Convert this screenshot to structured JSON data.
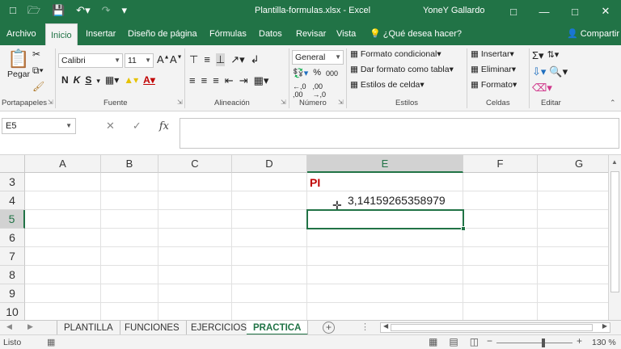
{
  "app": {
    "window_title": "Plantilla-formulas.xlsx  -  Excel",
    "user": "YoneY Gallardo",
    "accent": "#217346"
  },
  "qat": {
    "icons": [
      "new-file-icon",
      "open-folder-icon",
      "save-icon",
      "undo-icon",
      "redo-icon",
      "customize-qat-icon"
    ]
  },
  "window_controls": {
    "icons": [
      "ribbon-display-icon",
      "minimize-icon",
      "maximize-icon",
      "close-icon"
    ]
  },
  "tabs": [
    {
      "label": "Archivo"
    },
    {
      "label": "Inicio",
      "active": true
    },
    {
      "label": "Insertar"
    },
    {
      "label": "Diseño de página"
    },
    {
      "label": "Fórmulas"
    },
    {
      "label": "Datos"
    },
    {
      "label": "Revisar"
    },
    {
      "label": "Vista"
    }
  ],
  "tell_me": "¿Qué desea hacer?",
  "share": "Compartir",
  "ribbon": {
    "clipboard": {
      "paste": "Pegar",
      "group": "Portapapeles"
    },
    "font": {
      "name": "Calibri",
      "size": "11",
      "bold": "N",
      "italic": "K",
      "underline": "S",
      "group": "Fuente"
    },
    "alignment": {
      "group": "Alineación"
    },
    "number": {
      "format": "General",
      "group": "Número"
    },
    "styles": {
      "conditional": "Formato condicional",
      "as_table": "Dar formato como tabla",
      "cell_styles": "Estilos de celda",
      "group": "Estilos"
    },
    "cells": {
      "insert": "Insertar",
      "delete": "Eliminar",
      "format": "Formato",
      "group": "Celdas"
    },
    "editing": {
      "group": "Editar"
    }
  },
  "formula_bar": {
    "name_box": "E5",
    "fx": "fx",
    "value": ""
  },
  "grid": {
    "columns": [
      "A",
      "B",
      "C",
      "D",
      "E",
      "F",
      "G"
    ],
    "selected_column": "E",
    "rows": [
      "3",
      "4",
      "5",
      "6",
      "7",
      "8",
      "9",
      "10"
    ],
    "selected_row": "5",
    "cells": {
      "E3": "PI",
      "E4": "3,14159265358979"
    },
    "label_color": "#c00000"
  },
  "sheets": [
    {
      "label": "PLANTILLA"
    },
    {
      "label": "FUNCIONES"
    },
    {
      "label": "EJERCICIOS"
    },
    {
      "label": "PRACTICA",
      "active": true
    }
  ],
  "status": {
    "ready": "Listo",
    "zoom": "130 %"
  }
}
